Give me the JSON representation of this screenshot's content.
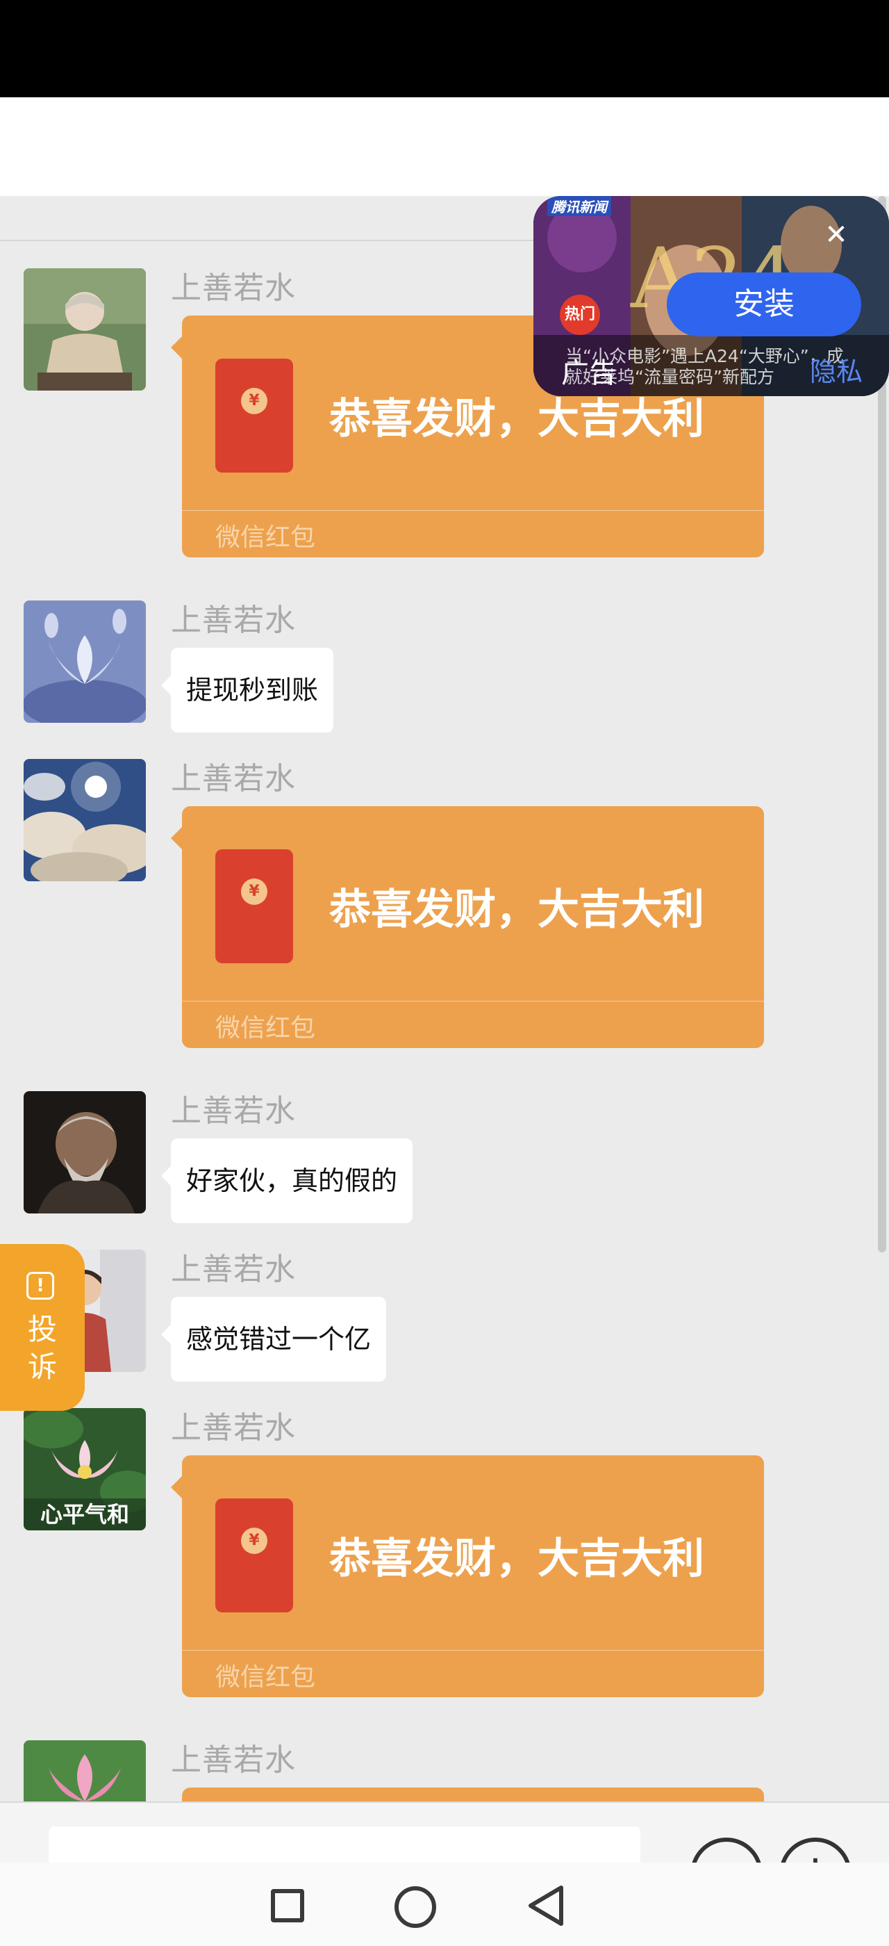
{
  "ad": {
    "source": "腾讯新闻",
    "install_label": "安装",
    "close_icon": "close-icon",
    "hot_badge": "热门",
    "ad_label": "广告",
    "privacy_label": "隐私",
    "headline": "当“小众电影”遇上A24“大野心”，成就好莱坞“流量密码”新配方"
  },
  "messages": [
    {
      "type": "redpacket",
      "sender": "上善若水",
      "title": "恭喜发财，大吉大利",
      "label": "微信红包"
    },
    {
      "type": "text",
      "sender": "上善若水",
      "text": "提现秒到账"
    },
    {
      "type": "redpacket",
      "sender": "上善若水",
      "title": "恭喜发财，大吉大利",
      "label": "微信红包"
    },
    {
      "type": "text",
      "sender": "上善若水",
      "text": "好家伙，真的假的"
    },
    {
      "type": "text",
      "sender": "上善若水",
      "text": "感觉错过一个亿"
    },
    {
      "type": "redpacket",
      "sender": "上善若水",
      "title": "恭喜发财，大吉大利",
      "label": "微信红包",
      "avatar_caption": "心平气和"
    },
    {
      "type": "redpacket",
      "sender": "上善若水"
    }
  ],
  "complain": {
    "line1": "投",
    "line2": "诉"
  },
  "colors": {
    "redpacket": "#eda14d",
    "install": "#2f64ee",
    "complain": "#f2a52a"
  }
}
